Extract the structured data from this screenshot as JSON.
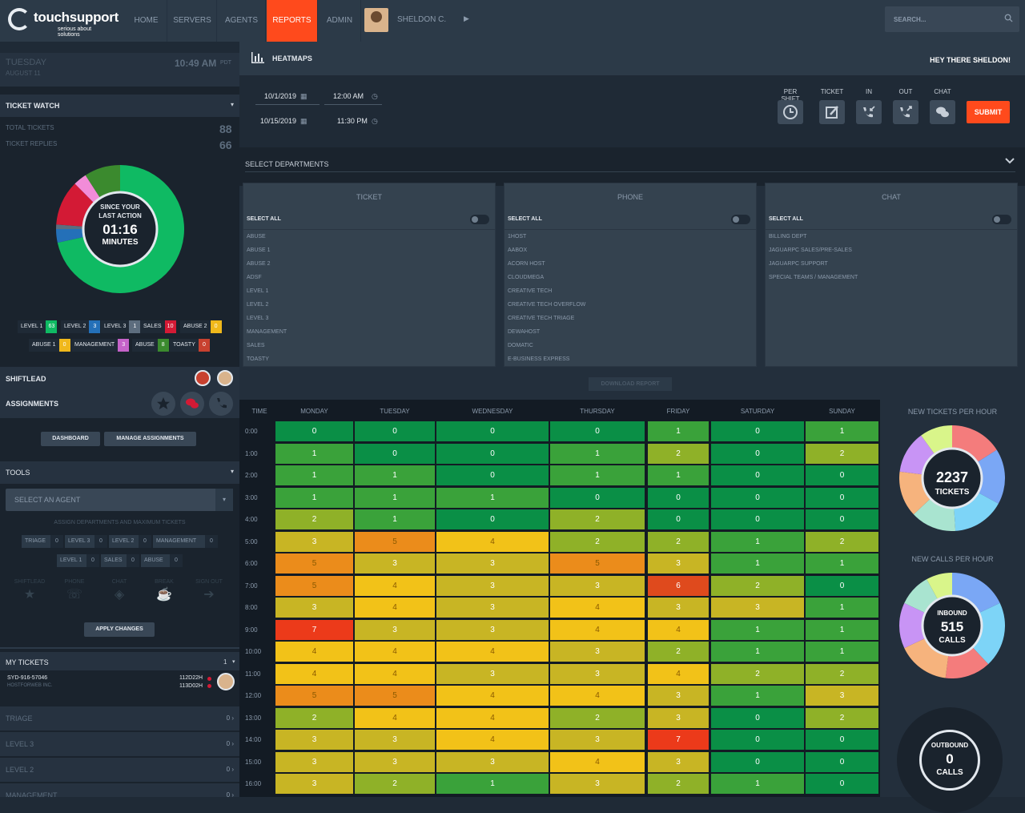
{
  "brand": {
    "name": "touchsupport",
    "tagline": "serious about solutions"
  },
  "nav": {
    "items": [
      "HOME",
      "SERVERS",
      "AGENTS",
      "REPORTS",
      "ADMIN"
    ],
    "active": "REPORTS",
    "user": "SHELDON C."
  },
  "search": {
    "placeholder": "SEARCH..."
  },
  "sidebar": {
    "day": "TUESDAY",
    "date": "AUGUST 11",
    "time": "10:49 AM",
    "tz": "PDT",
    "ticket_watch": {
      "title": "TICKET WATCH",
      "total_label": "TOTAL TICKETS",
      "total_value": "88",
      "replies_label": "TICKET REPLIES",
      "replies_value": "66",
      "center_line1": "SINCE YOUR",
      "center_line2": "LAST ACTION",
      "center_time": "01:16",
      "center_unit": "MINUTES",
      "donut": [
        {
          "name": "LEVEL 1",
          "value": 63,
          "color": "#0fba63"
        },
        {
          "name": "LEVEL 2",
          "value": 3,
          "color": "#2470b8"
        },
        {
          "name": "LEVEL 3",
          "value": 1,
          "color": "#5d6d7e"
        },
        {
          "name": "SALES",
          "value": 10,
          "color": "#d31a35"
        },
        {
          "name": "MANAGEMENT",
          "value": 3,
          "color": "#f28cd8"
        },
        {
          "name": "ABUSE",
          "value": 8,
          "color": "#3b8a2e"
        }
      ],
      "chips_row1": [
        {
          "label": "LEVEL 1",
          "value": "63",
          "color": "#0fba63"
        },
        {
          "label": "LEVEL 2",
          "value": "3",
          "color": "#2470b8"
        },
        {
          "label": "LEVEL 3",
          "value": "1",
          "color": "#5d6d7e"
        },
        {
          "label": "SALES",
          "value": "10",
          "color": "#d31a35"
        },
        {
          "label": "ABUSE 2",
          "value": "0",
          "color": "#f0b81b"
        }
      ],
      "chips_row2": [
        {
          "label": "ABUSE 1",
          "value": "0",
          "color": "#f0b81b"
        },
        {
          "label": "MANAGEMENT",
          "value": "3",
          "color": "#c563c9"
        },
        {
          "label": "ABUSE",
          "value": "8",
          "color": "#3b8a2e"
        },
        {
          "label": "TOASTY",
          "value": "0",
          "color": "#c8412f"
        }
      ]
    },
    "shiftlead": "SHIFTLEAD",
    "assignments": {
      "title": "ASSIGNMENTS",
      "dashboard": "DASHBOARD",
      "manage": "MANAGE ASSIGNMENTS"
    },
    "tools": {
      "title": "TOOLS",
      "select_agent": "SELECT AN AGENT",
      "assign_label": "ASSIGN DEPARTMENTS AND MAXIMUM TICKETS",
      "row1": [
        {
          "label": "TRIAGE",
          "value": "0"
        },
        {
          "label": "LEVEL 3",
          "value": "0"
        },
        {
          "label": "LEVEL 2",
          "value": "0"
        },
        {
          "label": "MANAGEMENT",
          "value": "0"
        }
      ],
      "row2": [
        {
          "label": "LEVEL 1",
          "value": "0"
        },
        {
          "label": "SALES",
          "value": "0"
        },
        {
          "label": "ABUSE",
          "value": "0"
        }
      ],
      "status": [
        "SHIFTLEAD",
        "PHONE",
        "CHAT",
        "BREAK",
        "SIGN OUT"
      ],
      "apply": "APPLY CHANGES"
    },
    "my_tickets": {
      "title": "MY TICKETS",
      "count": "1",
      "ticket_id": "SYD-916-57046",
      "company": "HOSTFORWEB INC.",
      "t1": "112D22H",
      "t2": "113D02H"
    },
    "queues": [
      {
        "label": "TRIAGE",
        "value": "0"
      },
      {
        "label": "LEVEL 3",
        "value": "0"
      },
      {
        "label": "LEVEL 2",
        "value": "0"
      },
      {
        "label": "MANAGEMENT",
        "value": "0"
      }
    ]
  },
  "main": {
    "title": "HEATMAPS",
    "greeting": "HEY THERE SHELDON!",
    "from_date": "10/1/2019",
    "from_time": "12:00 AM",
    "to_date": "10/15/2019",
    "to_time": "11:30 PM",
    "toggles": [
      "PER SHIFT",
      "TICKET",
      "IN",
      "OUT",
      "CHAT"
    ],
    "submit": "SUBMIT",
    "select_departments": "SELECT DEPARTMENTS",
    "select_all": "SELECT ALL",
    "departments": [
      {
        "name": "TICKET",
        "items": [
          "ABUSE",
          "ABUSE 1",
          "ABUSE 2",
          "ADSF",
          "LEVEL 1",
          "LEVEL 2",
          "LEVEL 3",
          "MANAGEMENT",
          "SALES",
          "TOASTY"
        ]
      },
      {
        "name": "PHONE",
        "items": [
          "1HOST",
          "AABOX",
          "ACORN HOST",
          "CLOUDMEGA",
          "CREATIVE TECH",
          "CREATIVE TECH OVERFLOW",
          "CREATIVE TECH TRIAGE",
          "DEWAHOST",
          "DOMATIC",
          "E-BUSINESS EXPRESS"
        ]
      },
      {
        "name": "CHAT",
        "items": [
          "BILLING DEPT",
          "JAGUARPC SALES/PRE-SALES",
          "JAGUARPC SUPPORT",
          "SPECIAL TEAMS / MANAGEMENT"
        ]
      }
    ],
    "download": "DOWNLOAD REPORT"
  },
  "heatmap": {
    "time_header": "TIME",
    "days": [
      "MONDAY",
      "TUESDAY",
      "WEDNESDAY",
      "THURSDAY",
      "FRIDAY",
      "SATURDAY",
      "SUNDAY"
    ],
    "times": [
      "0:00",
      "1:00",
      "2:00",
      "3:00",
      "4:00",
      "5:00",
      "6:00",
      "7:00",
      "8:00",
      "9:00",
      "10:00",
      "11:00",
      "12:00",
      "13:00",
      "14:00",
      "15:00",
      "16:00"
    ],
    "values": [
      [
        0,
        0,
        0,
        0,
        1,
        0,
        1
      ],
      [
        1,
        0,
        0,
        1,
        2,
        0,
        2
      ],
      [
        1,
        1,
        0,
        1,
        1,
        0,
        0
      ],
      [
        1,
        1,
        1,
        0,
        0,
        0,
        0
      ],
      [
        2,
        1,
        0,
        2,
        0,
        0,
        0
      ],
      [
        3,
        5,
        4,
        2,
        2,
        1,
        2
      ],
      [
        5,
        3,
        3,
        5,
        3,
        1,
        1
      ],
      [
        5,
        4,
        3,
        3,
        6,
        2,
        0
      ],
      [
        3,
        4,
        3,
        4,
        3,
        3,
        1
      ],
      [
        7,
        3,
        3,
        4,
        4,
        1,
        1
      ],
      [
        4,
        4,
        4,
        3,
        2,
        1,
        1
      ],
      [
        4,
        4,
        3,
        3,
        4,
        2,
        2
      ],
      [
        5,
        5,
        4,
        4,
        3,
        1,
        3
      ],
      [
        2,
        4,
        4,
        2,
        3,
        0,
        2
      ],
      [
        3,
        3,
        4,
        3,
        7,
        0,
        0
      ],
      [
        3,
        3,
        3,
        4,
        3,
        0,
        0
      ],
      [
        3,
        2,
        1,
        3,
        2,
        1,
        0
      ]
    ]
  },
  "stats": {
    "tickets_title": "NEW TICKETS PER HOUR",
    "tickets_value": "2237",
    "tickets_unit": "TICKETS",
    "calls_title": "NEW CALLS PER HOUR",
    "inbound_label": "INBOUND",
    "inbound_value": "515",
    "inbound_unit": "CALLS",
    "outbound_label": "OUTBOUND",
    "outbound_value": "0",
    "outbound_unit": "CALLS"
  }
}
